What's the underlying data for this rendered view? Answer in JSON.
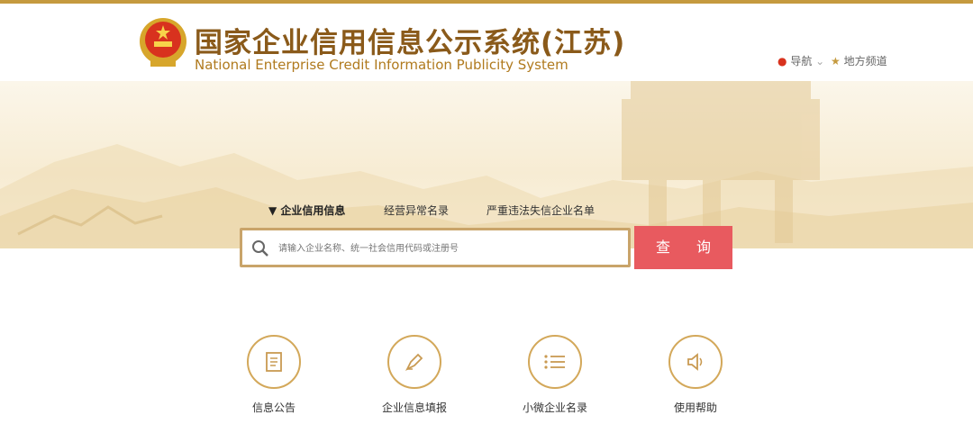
{
  "header": {
    "title_cn": "国家企业信用信息公示系统(江苏)",
    "title_en": "National Enterprise Credit Information Publicity System",
    "nav_guide": "导航",
    "nav_local": "地方频道"
  },
  "tabs": [
    {
      "label": "企业信用信息",
      "active": true
    },
    {
      "label": "经营异常名录",
      "active": false
    },
    {
      "label": "严重违法失信企业名单",
      "active": false
    }
  ],
  "search": {
    "placeholder": "请输入企业名称、统一社会信用代码或注册号",
    "button_label": "查 询"
  },
  "features": [
    {
      "label": "信息公告",
      "icon": "document-icon"
    },
    {
      "label": "企业信息填报",
      "icon": "pen-icon"
    },
    {
      "label": "小微企业名录",
      "icon": "list-icon"
    },
    {
      "label": "使用帮助",
      "icon": "speaker-icon"
    }
  ],
  "colors": {
    "accent_gold": "#c59a3f",
    "search_button": "#e85a5f",
    "title_brown": "#8a5a1a"
  }
}
